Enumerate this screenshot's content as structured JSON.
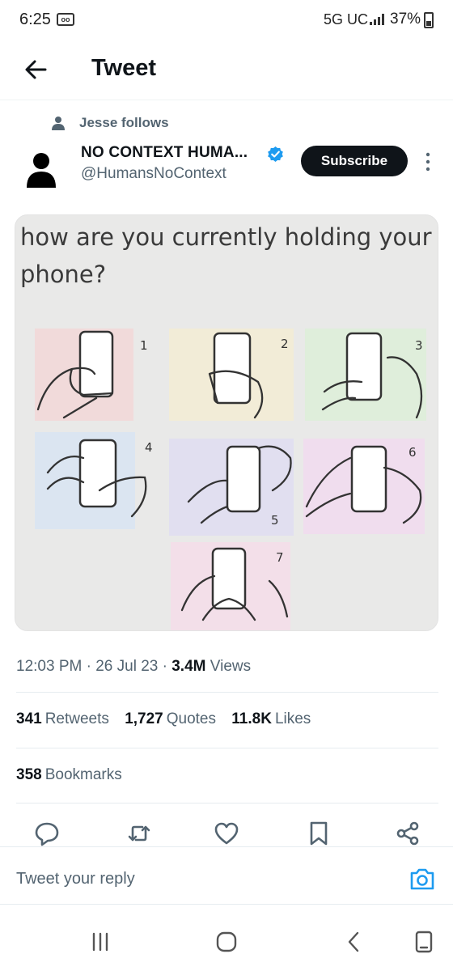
{
  "status_bar": {
    "time": "6:25",
    "network": "5G UC",
    "battery": "37%"
  },
  "header": {
    "title": "Tweet"
  },
  "tweet": {
    "social_context": "Jesse follows",
    "author_name": "NO CONTEXT HUMA...",
    "author_handle": "@HumansNoContext",
    "subscribe_label": "Subscribe",
    "media_caption": "how are you currently holding your phone?",
    "media_numbers": [
      "1",
      "2",
      "3",
      "4",
      "5",
      "6",
      "7"
    ],
    "time": "12:03 PM",
    "separator": "·",
    "date": "26 Jul 23",
    "views_count": "3.4M",
    "views_label": "Views",
    "stats": [
      {
        "count": "341",
        "label": "Retweets"
      },
      {
        "count": "1,727",
        "label": "Quotes"
      },
      {
        "count": "11.8K",
        "label": "Likes"
      }
    ],
    "bookmarks_count": "358",
    "bookmarks_label": "Bookmarks"
  },
  "actions": [
    "reply-icon",
    "retweet-icon",
    "like-icon",
    "bookmark-icon",
    "share-icon"
  ],
  "reply": {
    "placeholder": "Tweet your reply"
  },
  "colors": {
    "text_primary": "#0f1419",
    "text_secondary": "#536471",
    "accent": "#1d9bf0",
    "button_dark": "#0f1419"
  }
}
